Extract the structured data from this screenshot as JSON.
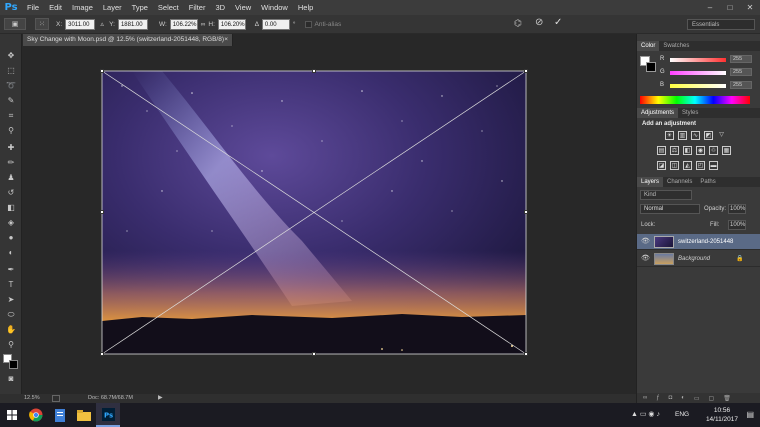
{
  "app": {
    "logo": "Ps"
  },
  "menu": [
    "File",
    "Edit",
    "Image",
    "Layer",
    "Type",
    "Select",
    "Filter",
    "3D",
    "View",
    "Window",
    "Help"
  ],
  "window_controls": {
    "minimize": "–",
    "maximize": "□",
    "close": "✕"
  },
  "options": {
    "x_label": "X:",
    "x_value": "3011.00 p",
    "y_label": "Y:",
    "y_value": "1881.00 p",
    "w_label": "W:",
    "w_value": "106.22%",
    "link_glyph": "∞",
    "h_label": "H:",
    "h_value": "106.20%",
    "angle_label": "∆",
    "angle_value": "0.00",
    "angle_unit": "°",
    "antialias_label": "Anti-alias",
    "workspace": "Essentials"
  },
  "document": {
    "tab_title": "Sky Change with Moon.psd @ 12.5% (switzerland-2051448, RGB/8)",
    "tab_close": "×",
    "zoom": "12.5%",
    "doc_size": "Doc: 68.7M/68.7M"
  },
  "panels": {
    "color_tabs": [
      "Color",
      "Swatches"
    ],
    "channels": [
      {
        "label": "R",
        "value": "255",
        "fill": 1.0,
        "color": "#ff3030"
      },
      {
        "label": "G",
        "value": "255",
        "fill": 1.0,
        "color": "#30d030"
      },
      {
        "label": "B",
        "value": "255",
        "fill": 1.0,
        "color": "#3060ff"
      }
    ],
    "adjustment_tabs": [
      "Adjustments",
      "Styles"
    ],
    "adjustment_title": "Add an adjustment",
    "layer_tabs": [
      "Layers",
      "Channels",
      "Paths"
    ],
    "layer_kind": "Kind",
    "blend_mode": "Normal",
    "opacity_label": "Opacity:",
    "opacity_value": "100%",
    "lock_label": "Lock:",
    "fill_label": "Fill:",
    "fill_value": "100%",
    "layers": [
      {
        "name": "switzerland-2051448",
        "selected": true
      },
      {
        "name": "Background",
        "selected": false
      }
    ]
  },
  "taskbar": {
    "lang": "ENG",
    "time": "10:56",
    "date": "14/11/2017"
  }
}
